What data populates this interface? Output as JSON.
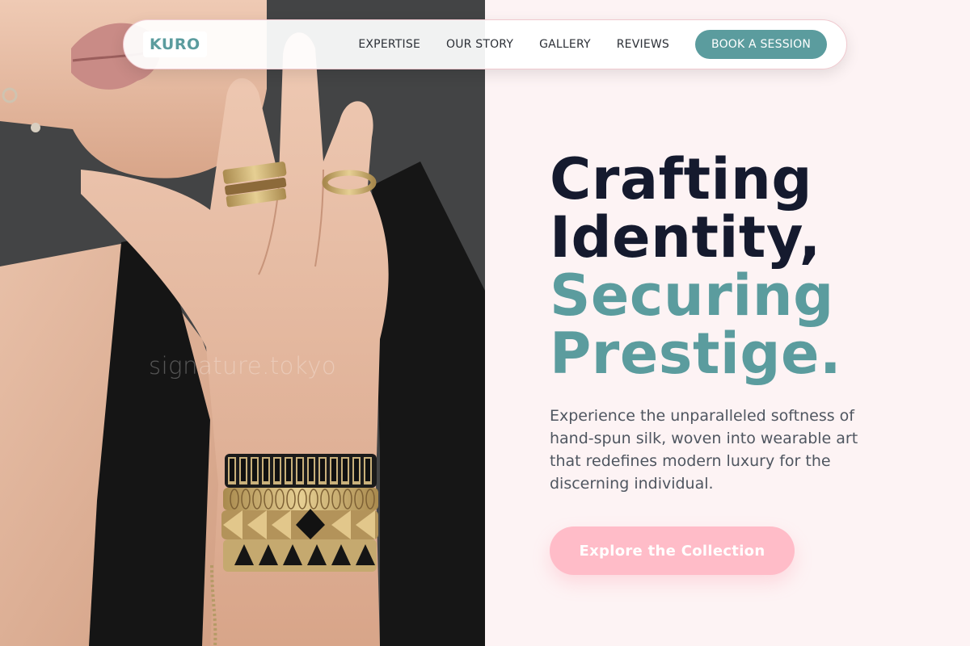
{
  "brand": {
    "logo_text": "KURO"
  },
  "nav": {
    "links": [
      "EXPERTISE",
      "OUR STORY",
      "GALLERY",
      "REVIEWS"
    ],
    "cta_label": "BOOK A SESSION"
  },
  "hero": {
    "title_lines_dark": [
      "Crafting",
      "Identity,"
    ],
    "title_lines_accent": [
      "Securing",
      "Prestige."
    ],
    "description": "Experience the unparalleled softness of hand-spun silk, woven into wearable art that redefines modern luxury for the discerning individual.",
    "cta_label": "Explore the Collection"
  },
  "photo": {
    "watermark": "signature.tokyo",
    "subject": "model-wearing-gold-rings-and-bracelets"
  },
  "colors": {
    "accent_teal": "#5b9c9e",
    "dark_navy": "#151a2e",
    "cta_pink": "#ffbcc8",
    "page_background": "#fdf3f4"
  }
}
